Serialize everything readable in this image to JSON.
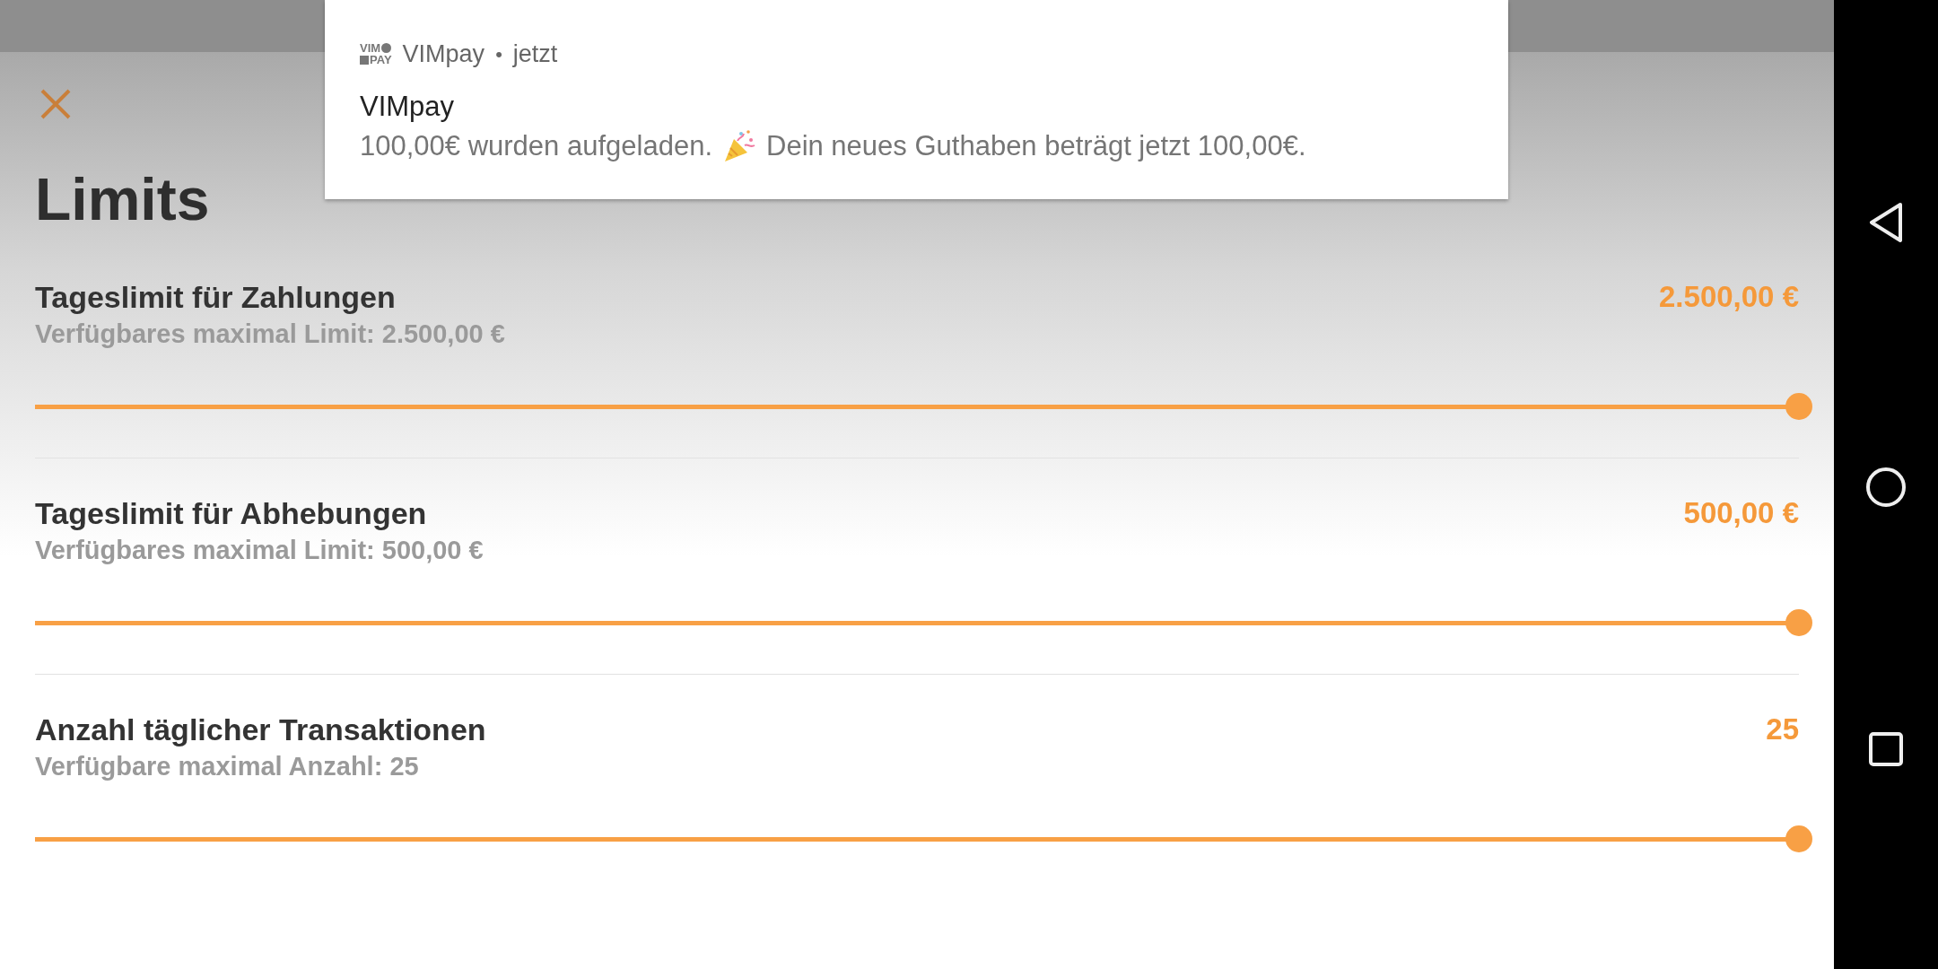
{
  "notification": {
    "logo_top": "VIM",
    "logo_bottom": "PAY",
    "app": "VIMpay",
    "separator": "•",
    "time": "jetzt",
    "title": "VIMpay",
    "message_before": "100,00€ wurden aufgeladen.",
    "message_after": "Dein neues Guthaben beträgt jetzt 100,00€."
  },
  "page": {
    "title": "Limits"
  },
  "limits": [
    {
      "title": "Tageslimit für Zahlungen",
      "subtitle": "Verfügbares maximal Limit: 2.500,00 €",
      "value": "2.500,00 €",
      "level": 1
    },
    {
      "title": "Tageslimit für Abhebungen",
      "subtitle": "Verfügbares maximal Limit: 500,00 €",
      "value": "500,00 €",
      "level": 1
    },
    {
      "title": "Anzahl täglicher Transaktionen",
      "subtitle": "Verfügbare maximal Anzahl: 25",
      "value": "25",
      "level": 1
    }
  ]
}
